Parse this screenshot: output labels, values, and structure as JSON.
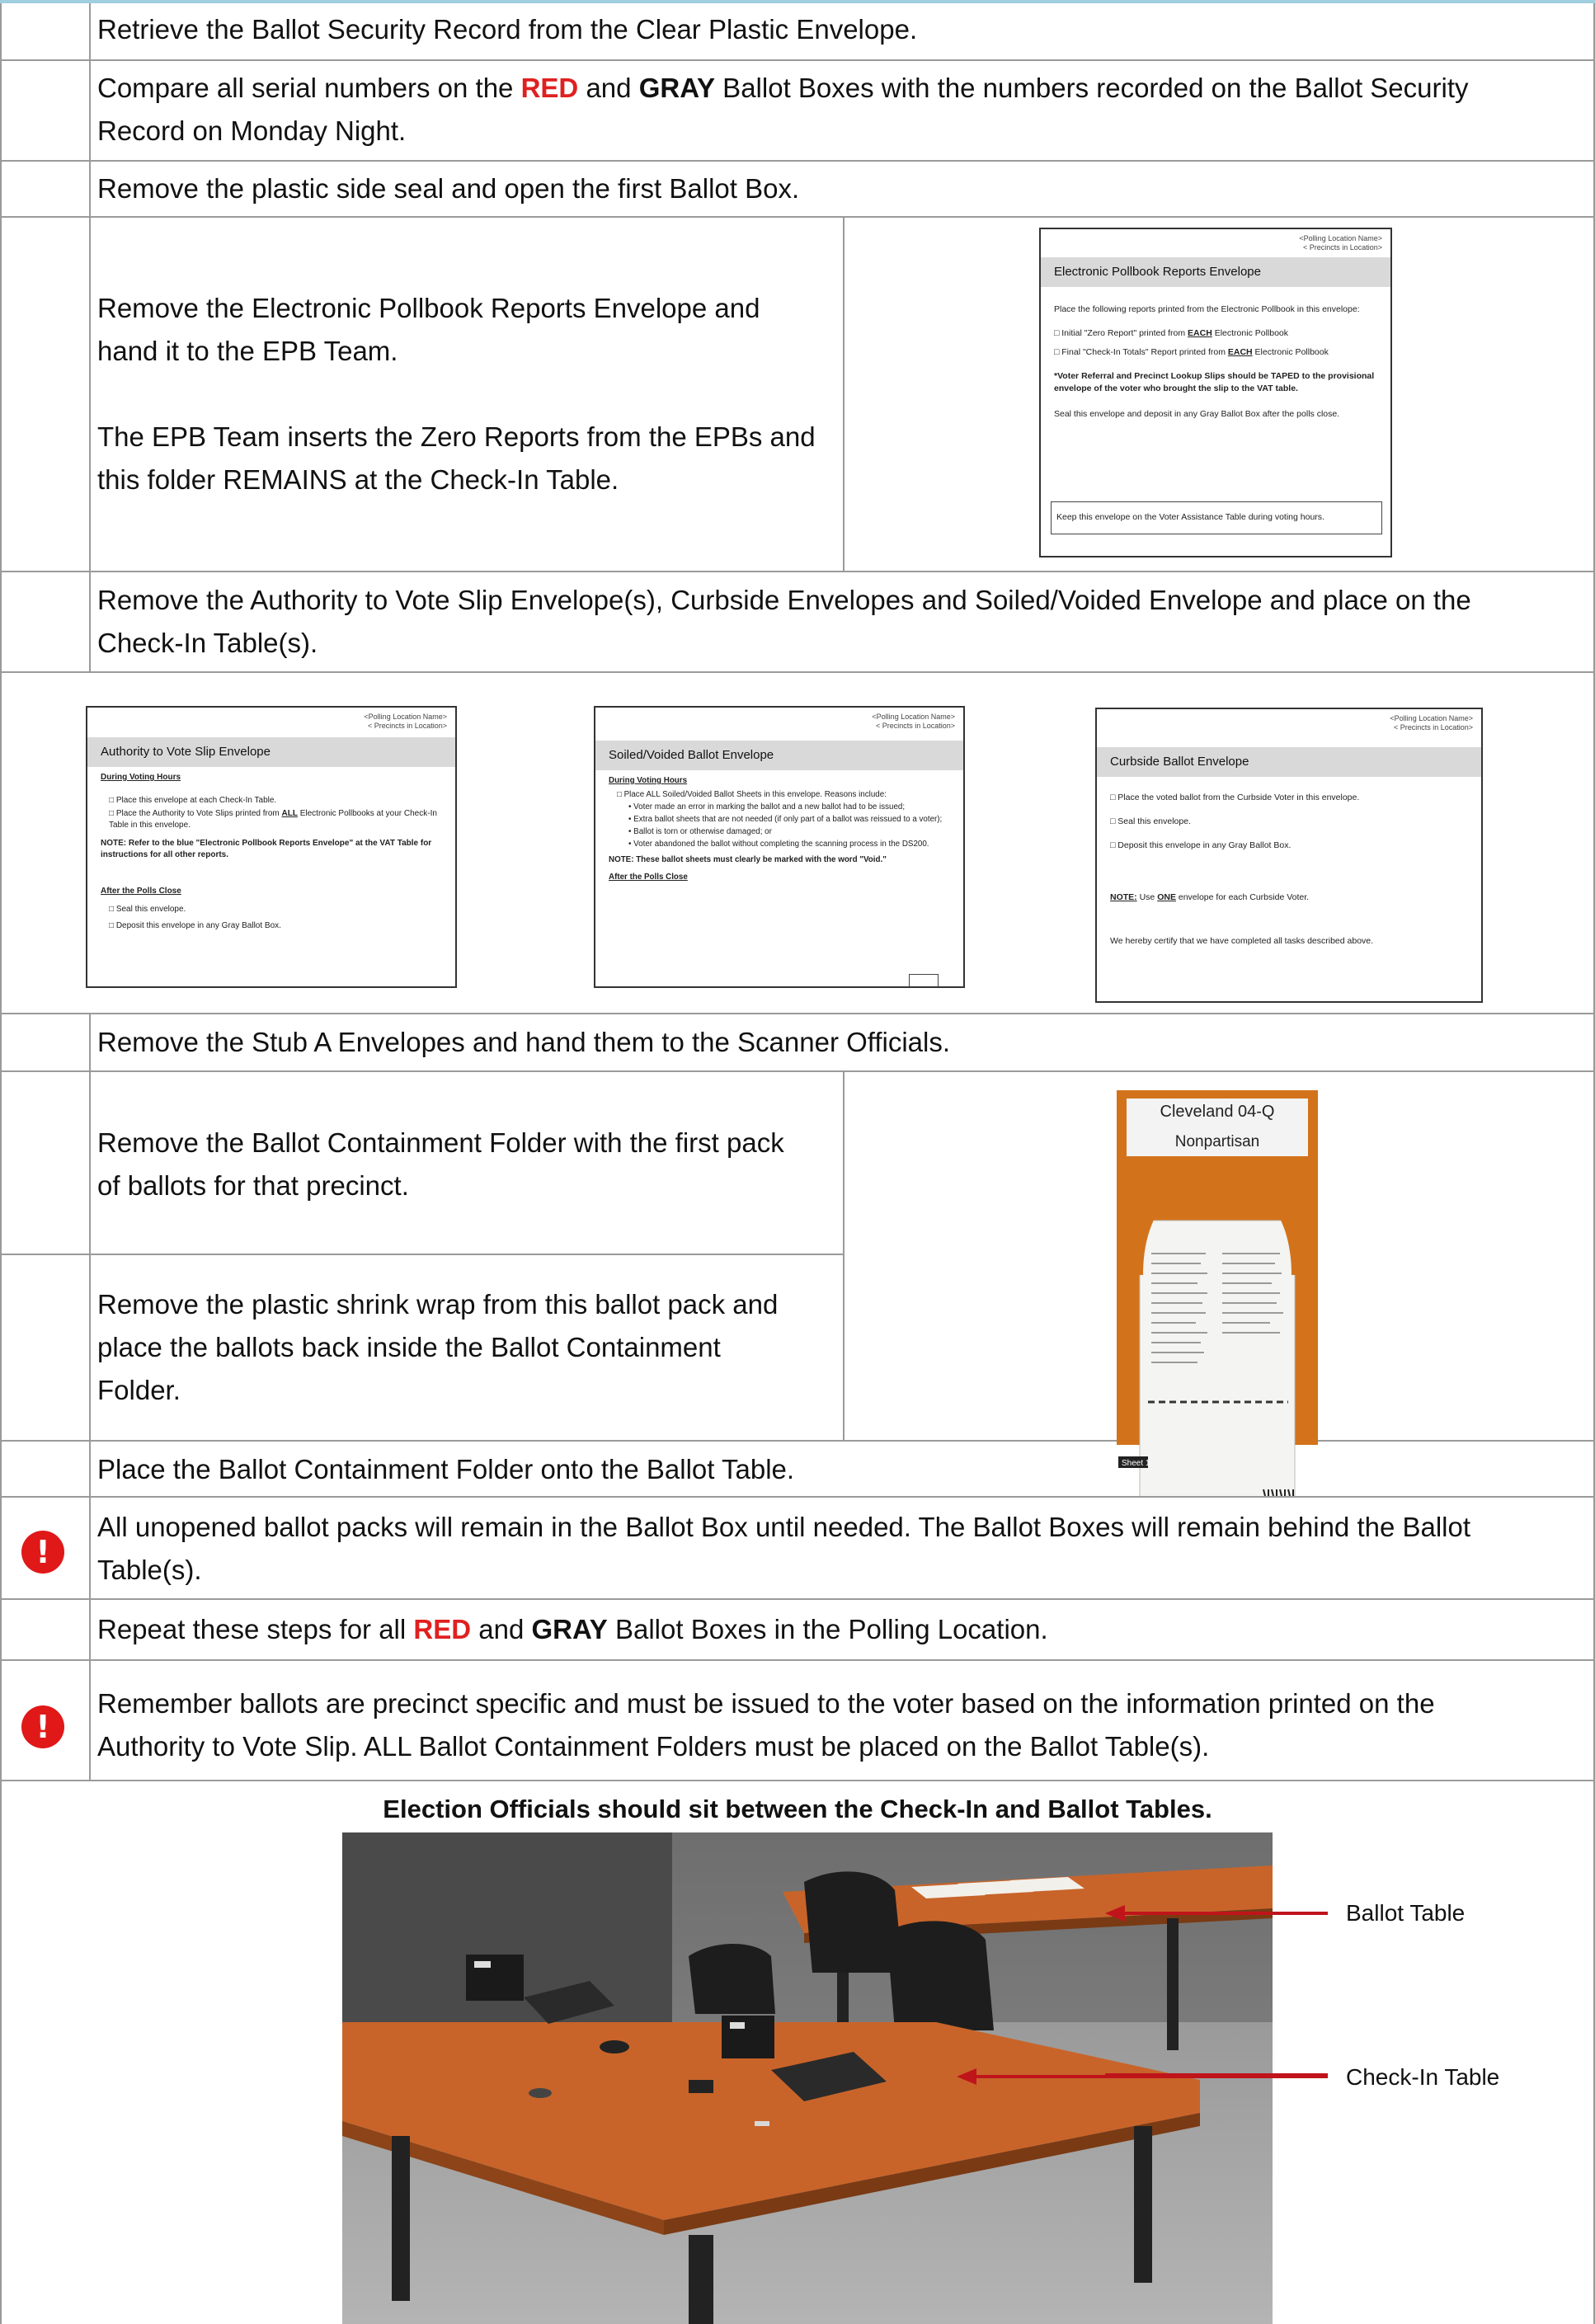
{
  "steps": {
    "s1": "Retrieve the Ballot Security Record from the Clear Plastic Envelope.",
    "s2a": "Compare all serial numbers on the ",
    "s2red": "RED",
    "s2b": " and ",
    "s2gray": "GRAY",
    "s2c": " Ballot Boxes with the numbers recorded on the Ballot Security",
    "s2d": "Record on Monday Night.",
    "s3": "Remove the plastic side seal and open the first Ballot Box.",
    "s4a1": "Remove the Electronic Pollbook Reports Envelope and",
    "s4a2": "hand it to the EPB Team.",
    "s4b1": "The EPB Team inserts the Zero Reports from the EPBs and",
    "s4b2": "this folder REMAINS at the Check-In Table.",
    "s5a": "Remove the Authority to Vote Slip Envelope(s), Curbside Envelopes and Soiled/Voided Envelope and place on the",
    "s5b": "Check-In Table(s).",
    "s6": "Remove the Stub A Envelopes and hand them to the Scanner Officials.",
    "s7a": "Remove the Ballot Containment Folder with the first pack",
    "s7b": "of ballots for that precinct.",
    "s8a": "Remove the plastic shrink wrap from this ballot pack and",
    "s8b": "place the ballots back inside the Ballot Containment",
    "s8c": "Folder.",
    "s9": "Place the Ballot Containment Folder onto the Ballot Table.",
    "s10a": "All unopened ballot packs will remain in the Ballot Box until needed. The Ballot Boxes will remain behind the Ballot",
    "s10b": "Table(s).",
    "s11a": "Repeat these steps for all ",
    "s11red": "RED",
    "s11b": " and ",
    "s11gray": "GRAY",
    "s11c": " Ballot Boxes in the Polling Location.",
    "s12a": "Remember ballots are precinct specific and must be issued to the voter based on the information printed on the",
    "s12b": "Authority to Vote Slip.  ALL Ballot Containment Folders must be placed on the Ballot Table(s).",
    "s13": "Election Officials should sit between the Check-In and Ballot Tables."
  },
  "alert_glyph": "!",
  "envelopes": {
    "location_hdr1": "<Polling Location Name>",
    "location_hdr2": "< Precincts in Location>",
    "epb": {
      "title": "Electronic Pollbook Reports Envelope",
      "intro": "Place the following reports printed from the Electronic Pollbook in this envelope:",
      "item1a": "Initial \"Zero Report\" printed from ",
      "item1u": "EACH",
      "item1b": " Electronic Pollbook",
      "item2a": "Final \"Check-In Totals\" Report printed from ",
      "item2u": "EACH",
      "item2b": " Electronic Pollbook",
      "note": "*Voter Referral and Precinct Lookup Slips should be TAPED to the provisional envelope of the voter who brought the slip to the VAT table.",
      "seal": "Seal this envelope and deposit in any Gray Ballot Box after the polls close.",
      "keep": "Keep this envelope on the Voter Assistance Table during voting hours."
    },
    "atv": {
      "title": "Authority to Vote Slip Envelope",
      "during": "During Voting Hours",
      "i1": "Place this envelope at each Check-In Table.",
      "i2a": "Place the Authority to Vote Slips printed from ",
      "i2u": "ALL",
      "i2b": " Electronic Pollbooks at your Check-In Table in this envelope.",
      "note": "NOTE:  Refer to the blue \"Electronic Pollbook Reports Envelope\" at the VAT Table for instructions for all other reports.",
      "after": "After the Polls Close",
      "a1": "Seal this envelope.",
      "a2": "Deposit this envelope in any Gray Ballot Box."
    },
    "soiled": {
      "title": "Soiled/Voided Ballot Envelope",
      "during": "During Voting Hours",
      "intro": "Place ALL Soiled/Voided Ballot Sheets in this envelope. Reasons include:",
      "b1": "Voter made an error in marking the ballot and a new ballot had to be issued;",
      "b2": "Extra ballot sheets that are not needed (if only part of a ballot was reissued to a voter);",
      "b3": "Ballot is torn or otherwise damaged; or",
      "b4": "Voter abandoned the ballot without completing the scanning process in the DS200.",
      "note": "NOTE:  These ballot sheets must clearly be marked with the word \"Void.\"",
      "after": "After the Polls Close"
    },
    "curb": {
      "title": "Curbside Ballot Envelope",
      "i1": "Place the voted ballot from the Curbside Voter in this envelope.",
      "i2": "Seal this envelope.",
      "i3": "Deposit this envelope in any Gray Ballot Box.",
      "note_u": "NOTE:",
      "note_a": "  Use ",
      "note_one": "ONE",
      "note_b": " envelope for each Curbside Voter.",
      "certify": "We hereby certify that we have completed all tasks described above."
    }
  },
  "folder": {
    "precinct": "Cleveland 04-Q",
    "type": "Nonpartisan",
    "sheet": "Sheet 1"
  },
  "photo_labels": {
    "ballot_table": "Ballot Table",
    "checkin_table": "Check-In Table"
  },
  "colors": {
    "red_text": "#e02020",
    "alert": "#e01818",
    "border": "#9a9a9a",
    "arrow": "#c0141b",
    "table_wood": "#c8642a"
  }
}
